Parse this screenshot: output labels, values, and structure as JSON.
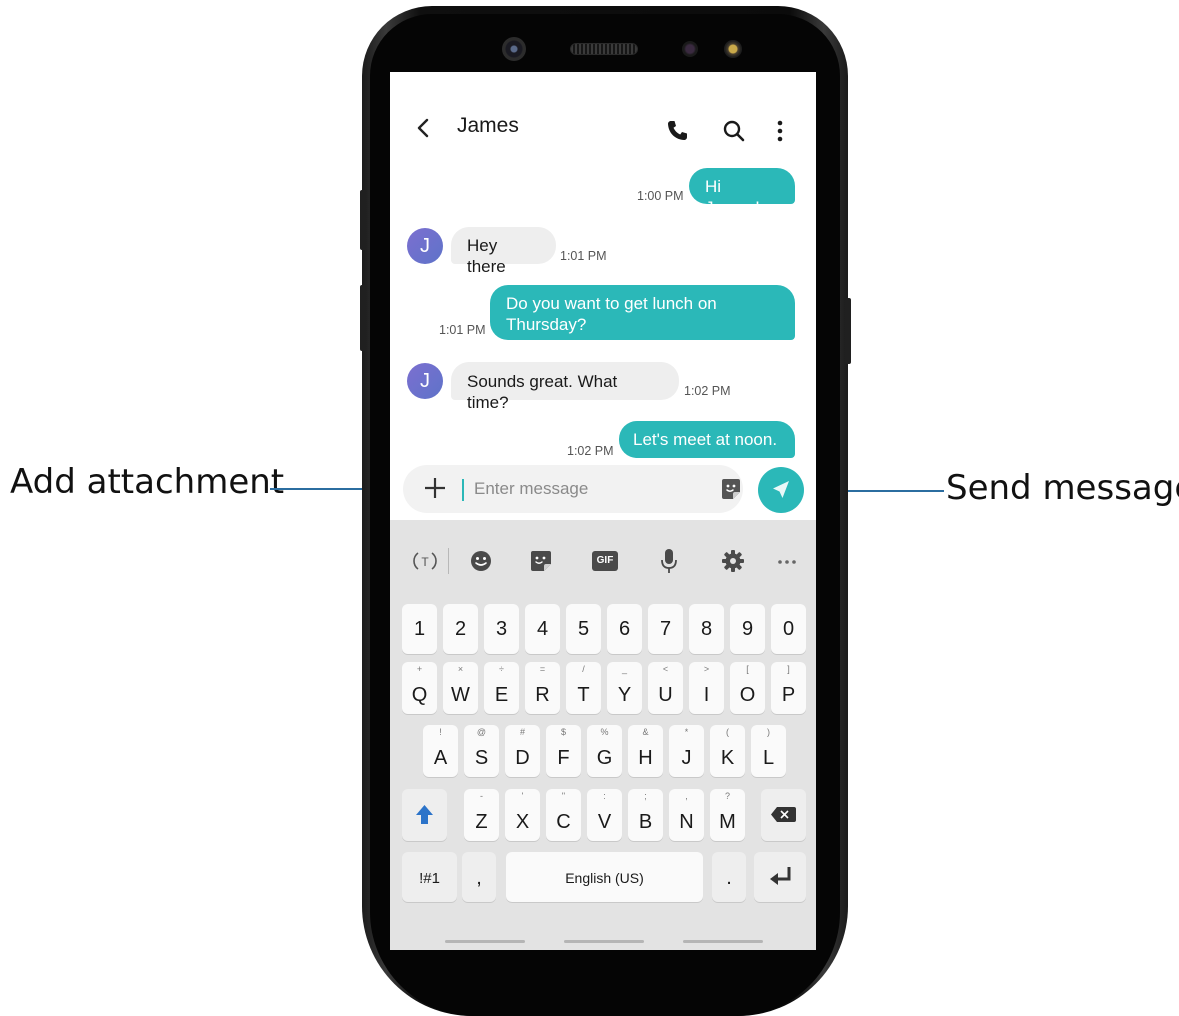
{
  "callouts": {
    "attachment": "Add attachment",
    "send": "Send message"
  },
  "header": {
    "contact_name": "James"
  },
  "messages": [
    {
      "direction": "out",
      "text": "Hi James!",
      "time": "1:00 PM"
    },
    {
      "direction": "in",
      "avatar": "J",
      "text": "Hey there",
      "time": "1:01 PM"
    },
    {
      "direction": "out",
      "text": "Do you want to get lunch on Thursday?",
      "time": "1:01 PM"
    },
    {
      "direction": "in",
      "avatar": "J",
      "text": "Sounds great. What time?",
      "time": "1:02 PM"
    },
    {
      "direction": "out",
      "text": "Let's meet at noon.",
      "time": "1:02 PM"
    }
  ],
  "composer": {
    "placeholder": "Enter message"
  },
  "keyboard": {
    "toolbar_icons": [
      "text-recognition-icon",
      "emoji-icon",
      "sticker-icon",
      "gif-icon",
      "microphone-icon",
      "settings-icon",
      "more-icon"
    ],
    "gif_label": "GIF",
    "numbers": [
      "1",
      "2",
      "3",
      "4",
      "5",
      "6",
      "7",
      "8",
      "9",
      "0"
    ],
    "row_q": [
      {
        "key": "Q",
        "hint": "+"
      },
      {
        "key": "W",
        "hint": "×"
      },
      {
        "key": "E",
        "hint": "÷"
      },
      {
        "key": "R",
        "hint": "="
      },
      {
        "key": "T",
        "hint": "/"
      },
      {
        "key": "Y",
        "hint": "_"
      },
      {
        "key": "U",
        "hint": "<"
      },
      {
        "key": "I",
        "hint": ">"
      },
      {
        "key": "O",
        "hint": "["
      },
      {
        "key": "P",
        "hint": "]"
      }
    ],
    "row_a": [
      {
        "key": "A",
        "hint": "!"
      },
      {
        "key": "S",
        "hint": "@"
      },
      {
        "key": "D",
        "hint": "#"
      },
      {
        "key": "F",
        "hint": "$"
      },
      {
        "key": "G",
        "hint": "%"
      },
      {
        "key": "H",
        "hint": "&"
      },
      {
        "key": "J",
        "hint": "*"
      },
      {
        "key": "K",
        "hint": "("
      },
      {
        "key": "L",
        "hint": ")"
      }
    ],
    "row_z": [
      {
        "key": "Z",
        "hint": "-"
      },
      {
        "key": "X",
        "hint": "'"
      },
      {
        "key": "C",
        "hint": "\""
      },
      {
        "key": "V",
        "hint": ":"
      },
      {
        "key": "B",
        "hint": ";"
      },
      {
        "key": "N",
        "hint": ","
      },
      {
        "key": "M",
        "hint": "?"
      }
    ],
    "symbols_label": "!#1",
    "comma_label": ",",
    "space_label": "English (US)",
    "period_label": "."
  },
  "colors": {
    "accent": "#2bb8b8",
    "callout_line": "#2b6da0"
  }
}
